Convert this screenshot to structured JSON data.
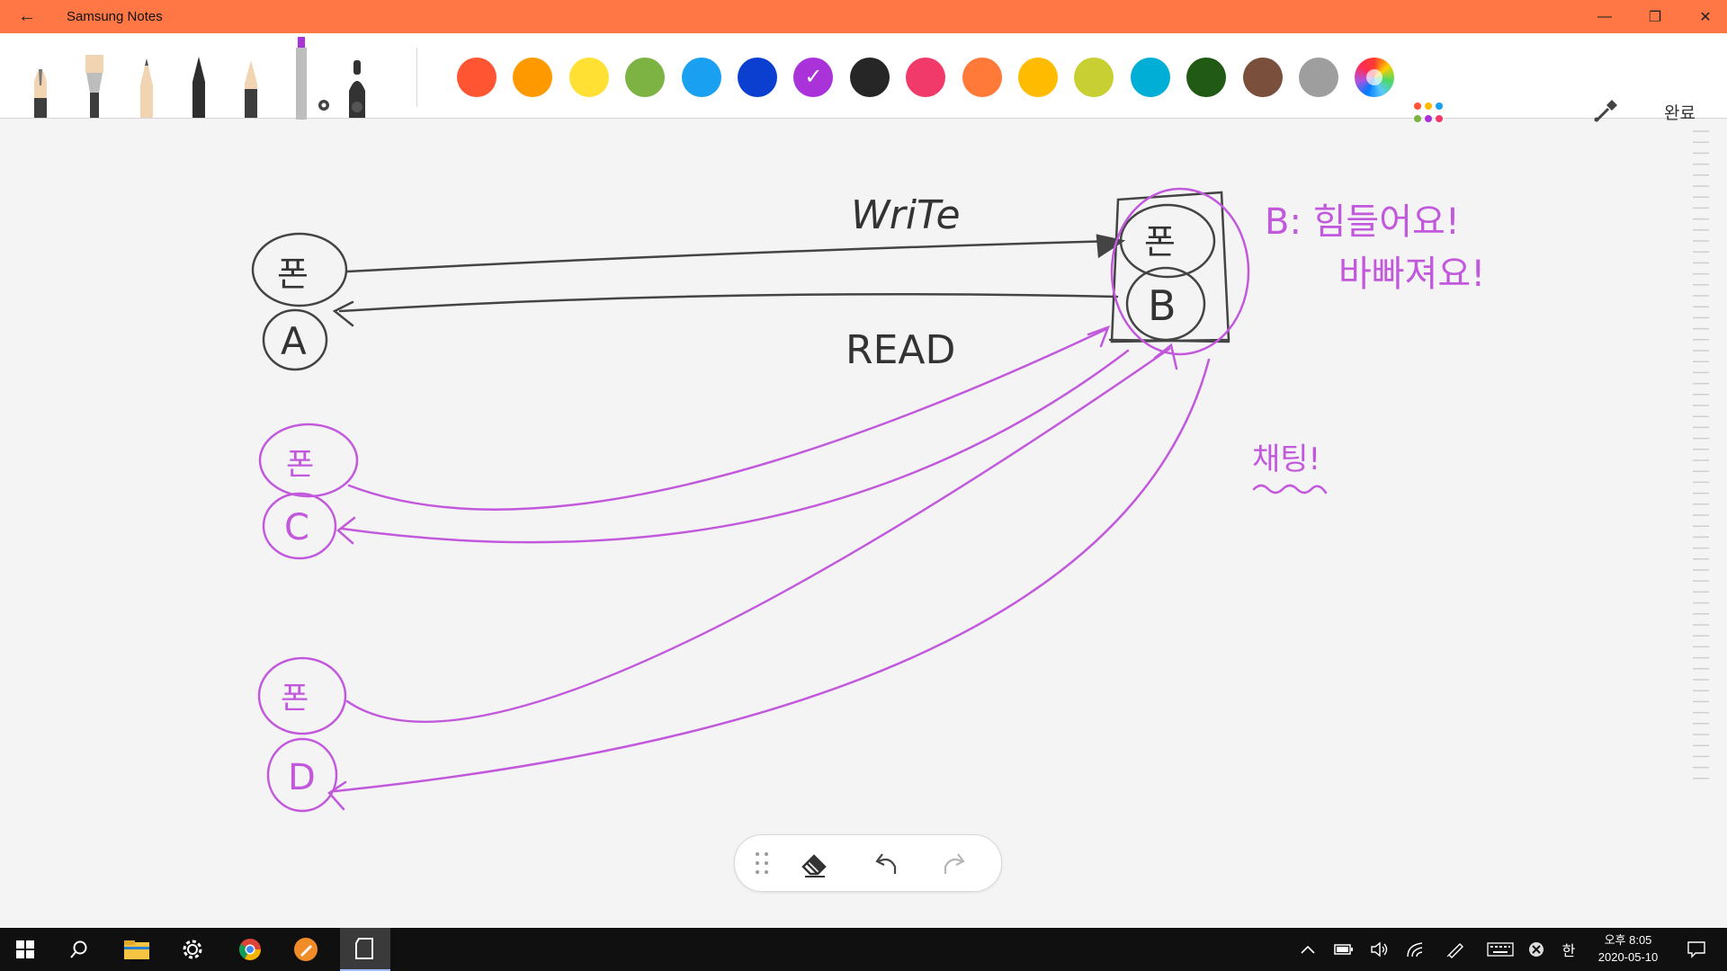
{
  "app": {
    "title": "Samsung Notes",
    "done_label": "완료"
  },
  "window": {
    "minimize": "—",
    "restore": "❐",
    "close": "✕"
  },
  "colors": {
    "titlebar": "#ff7745",
    "swatches": [
      "#ff5533",
      "#ff9900",
      "#ffe033",
      "#7cb342",
      "#1aa0f0",
      "#0b3fd0",
      "#a933d8",
      "#262626",
      "#f23a6a",
      "#ff7a38",
      "#ffbb00",
      "#c8cf33",
      "#00aed6",
      "#215a14",
      "#7a4f3c",
      "#9e9e9e"
    ],
    "selected_swatch_index": 6,
    "ink_dark": "#444444",
    "ink_purple": "#c259dc"
  },
  "pens": [
    "fountain-pen",
    "calligraphy-brush",
    "pencil",
    "pen",
    "marker",
    "highlighter-selected",
    "brush-pen"
  ],
  "drawing": {
    "write_label": "WriTe",
    "read_label": "READ",
    "a_bubble_top": "폰",
    "a_label": "A",
    "b_bubble_top": "폰",
    "b_label": "B",
    "c_bubble_top": "폰",
    "c_label": "C",
    "d_bubble_top": "폰",
    "d_label": "D",
    "b_note_line1": "B: 힘들어요!",
    "b_note_line2": "바빠져요!",
    "chat_label": "채팅!"
  },
  "bottom_toolbar": {
    "handle": "drag-handle",
    "eraser": "eraser",
    "undo": "undo",
    "redo": "redo"
  },
  "taskbar": {
    "clock_line1": "오후 8:05",
    "clock_line2": "2020-05-10",
    "ime": "한"
  }
}
